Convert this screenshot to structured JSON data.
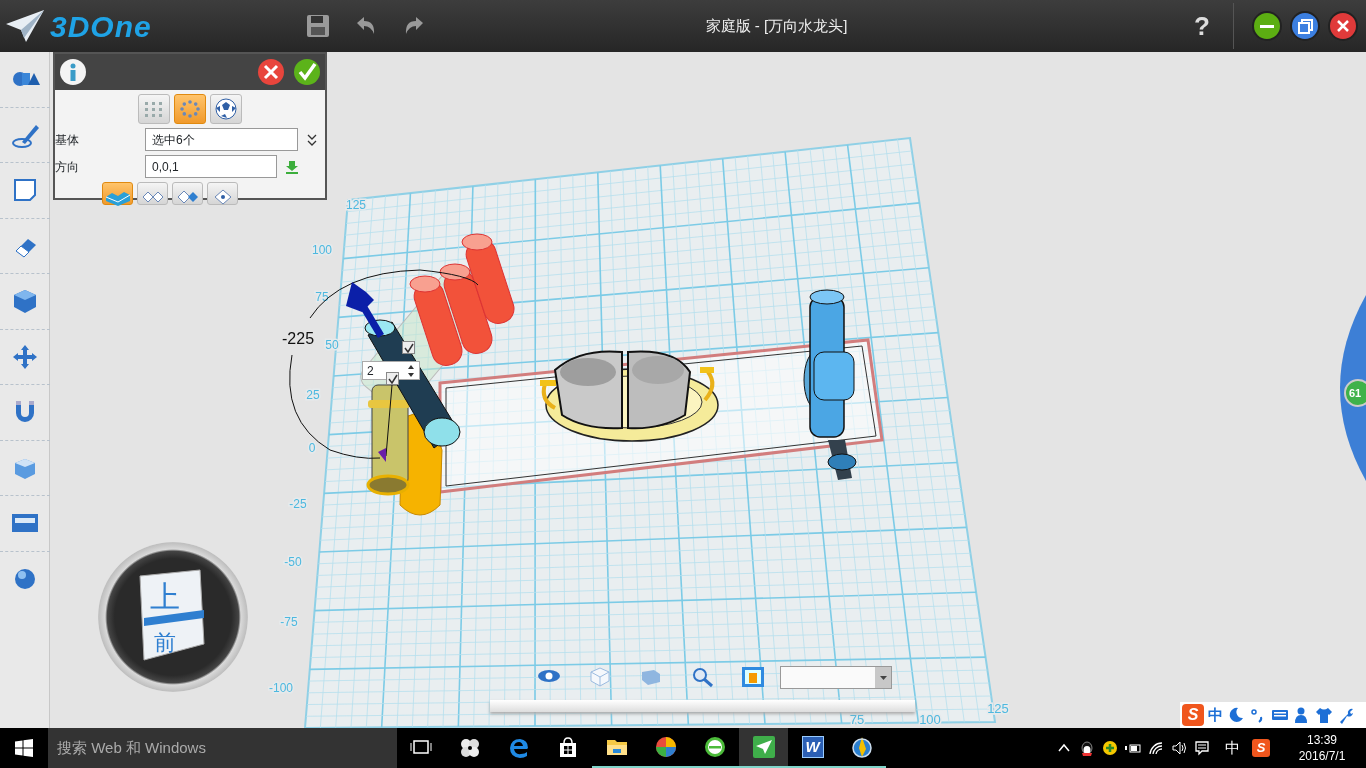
{
  "app": {
    "logo": "3DOne",
    "title": "家庭版 - [万向水龙头]",
    "help": "?"
  },
  "panel": {
    "tabs": [
      {
        "selected": false
      },
      {
        "selected": true
      },
      {
        "selected": false
      }
    ],
    "fields": [
      {
        "label": "基体",
        "value": "选中6个"
      },
      {
        "label": "方向",
        "value": "0,0,1"
      }
    ],
    "modes": [
      {
        "selected": true
      },
      {
        "selected": false
      },
      {
        "selected": false
      },
      {
        "selected": false
      }
    ]
  },
  "viewport": {
    "y_labels": [
      "125",
      "100",
      "75",
      "50",
      "25",
      "0",
      "-25",
      "-50",
      "-75",
      "-100"
    ],
    "x_labels": [
      "75",
      "100",
      "125"
    ],
    "angle_label": "-225",
    "count_field": {
      "value": "2"
    },
    "checks": [
      {
        "checked": true
      },
      {
        "checked": true
      }
    ],
    "view_cube": {
      "top": "上",
      "front": "前"
    },
    "side_tab": "61"
  },
  "ime_bar": {
    "logo": "S",
    "mode": "中"
  },
  "taskbar": {
    "search_placeholder": "搜索 Web 和 Windows",
    "apps": [
      {
        "running": false,
        "selected": false
      },
      {
        "running": false,
        "selected": false
      },
      {
        "running": false,
        "selected": false
      },
      {
        "running": false,
        "selected": false
      },
      {
        "running": true,
        "selected": false
      },
      {
        "running": true,
        "selected": false
      },
      {
        "running": true,
        "selected": false
      },
      {
        "running": true,
        "selected": true
      },
      {
        "running": true,
        "selected": false,
        "label": "W"
      },
      {
        "running": true,
        "selected": false
      }
    ],
    "tray_logo": "S",
    "tray_ime": "中",
    "time": "13:39",
    "date": "2016/7/1"
  }
}
